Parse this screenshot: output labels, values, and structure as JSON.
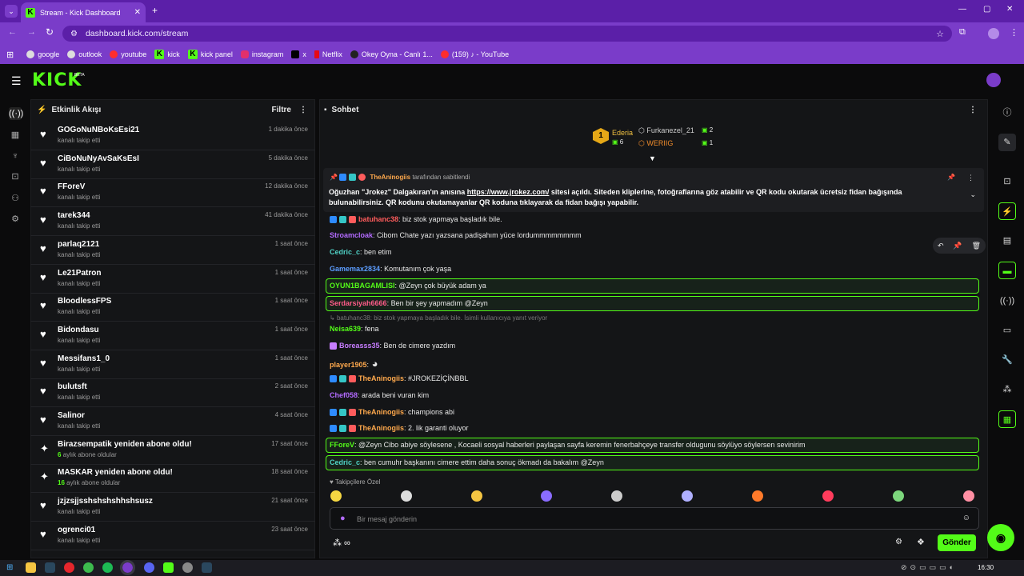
{
  "browser": {
    "tab_title": "Stream - Kick Dashboard",
    "url": "dashboard.kick.com/stream",
    "bookmarks": [
      "google",
      "outlook",
      "youtube",
      "kick",
      "kick panel",
      "instagram",
      "x",
      "Netflix",
      "Okey Oyna - Canlı 1...",
      "(159) ♪ - YouTube"
    ]
  },
  "site": {
    "logo": "KICK",
    "beta": "BETA"
  },
  "activity": {
    "title": "Etkinlik Akışı",
    "filter": "Filtre",
    "items": [
      {
        "name": "GOGoNuNBoKsEsi21",
        "sub": "kanalı takip etti",
        "time": "1 dakika önce",
        "icon": "heart-icon"
      },
      {
        "name": "CiBoNuNyAvSaKsEsI",
        "sub": "kanalı takip etti",
        "time": "5 dakika önce",
        "icon": "heart-icon"
      },
      {
        "name": "FForeV",
        "sub": "kanalı takip etti",
        "time": "12 dakika önce",
        "icon": "heart-icon"
      },
      {
        "name": "tarek344",
        "sub": "kanalı takip etti",
        "time": "41 dakika önce",
        "icon": "heart-icon"
      },
      {
        "name": "parlaq2121",
        "sub": "kanalı takip etti",
        "time": "1 saat önce",
        "icon": "heart-icon"
      },
      {
        "name": "Le21Patron",
        "sub": "kanalı takip etti",
        "time": "1 saat önce",
        "icon": "heart-icon"
      },
      {
        "name": "BloodlessFPS",
        "sub": "kanalı takip etti",
        "time": "1 saat önce",
        "icon": "heart-icon"
      },
      {
        "name": "Bidondasu",
        "sub": "kanalı takip etti",
        "time": "1 saat önce",
        "icon": "heart-icon"
      },
      {
        "name": "Messifans1_0",
        "sub": "kanalı takip etti",
        "time": "1 saat önce",
        "icon": "heart-icon"
      },
      {
        "name": "bulutsft",
        "sub": "kanalı takip etti",
        "time": "2 saat önce",
        "icon": "heart-icon"
      },
      {
        "name": "Salinor",
        "sub": "kanalı takip etti",
        "time": "4 saat önce",
        "icon": "heart-icon"
      },
      {
        "name": "Birazsempatik yeniden abone oldu!",
        "sub_count": "6",
        "sub": "aylık abone oldular",
        "time": "17 saat önce",
        "icon": "sparkle-icon"
      },
      {
        "name": "MASKAR yeniden abone oldu!",
        "sub_count": "16",
        "sub": "aylık abone oldular",
        "time": "18 saat önce",
        "icon": "sparkle-icon"
      },
      {
        "name": "jzjzsjjsshshshshhshsusz",
        "sub": "kanalı takip etti",
        "time": "21 saat önce",
        "icon": "heart-icon"
      },
      {
        "name": "ogrenci01",
        "sub": "kanalı takip etti",
        "time": "23 saat önce",
        "icon": "heart-icon"
      }
    ]
  },
  "chat": {
    "title": "Sohbet",
    "leaderboard": {
      "first": {
        "name": "Ederia",
        "count": "6",
        "rank": "1"
      },
      "second": {
        "name": "Furkanezel_21",
        "count": "2"
      },
      "third": {
        "name": "WERIIG",
        "count": "1"
      }
    },
    "pinned": {
      "author": "TheAninogiis",
      "suffix": "tarafından sabitlendi",
      "text_before": "Oğuzhan \"Jrokez\" Dalgakıran'ın anısına ",
      "link": "https://www.jrokez.com/",
      "text_after": " sitesi açıldı. Siteden kliplerine, fotoğraflarına göz atabilir ve QR kodu okutarak ücretsiz fidan bağışında bulunabilirsiniz. QR kodunu okutamayanlar QR koduna tıklayarak da fidan bağışı yapabilir."
    },
    "messages": [
      {
        "user": "batuhanc38",
        "color": "#ff5c5c",
        "text": ": biz stok yapmaya başladık bile."
      },
      {
        "user": "Stroamcloak",
        "color": "#b36bff",
        "text": ": Cibom Chate yazı yazsana padişahım yüce lordummmmmmmm"
      },
      {
        "user": "Cedric_c",
        "color": "#4fd1c5",
        "text": ": ben etim"
      },
      {
        "user": "Gamemax2834",
        "color": "#5c9dff",
        "text": ": Komutanım çok yaşa"
      },
      {
        "user": "OYUN1BAGAMLISI",
        "color": "#53fc18",
        "text": ": @Zeyn çok büyük adam ya"
      },
      {
        "user": "Serdarsiyah6666",
        "color": "#ff5c8a",
        "text": ": Ben bir şey yapmadım @Zeyn"
      },
      {
        "reply": "batuhanc38: biz stok yapmaya başladık bile. İsimli kullanıcıya yanıt veriyor"
      },
      {
        "user": "Neisa639",
        "color": "#53fc18",
        "text": ": fena"
      },
      {
        "user": "Boreasss35",
        "color": "#c77dff",
        "text": ": Ben de cimere yazdım"
      },
      {
        "user": "player1905",
        "color": "#ffa94d",
        "text": ":"
      },
      {
        "user": "TheAninogiis",
        "color": "#ffa94d",
        "text": ": #JROKEZİÇİNBBL"
      },
      {
        "user": "Chef058",
        "color": "#b36bff",
        "text": ": arada beni vuran kim"
      },
      {
        "user": "TheAninogiis",
        "color": "#ffa94d",
        "text": ": champions abi"
      },
      {
        "user": "TheAninogiis",
        "color": "#ffa94d",
        "text": ": 2. lik garanti oluyor"
      },
      {
        "user": "FForeV",
        "color": "#53fc18",
        "text": ": @Zeyn Cibo abiye söylesene , Kocaeli sosyal haberleri paylaşan sayfa keremin fenerbahçeye transfer oldugunu söylüyo söylersen sevinirim"
      },
      {
        "user": "Cedric_c",
        "color": "#4fd1c5",
        "text": ": ben cumuhr başkanını cimere ettim daha sonuç ökmadı da bakalım @Zeyn"
      }
    ],
    "emote_section": "Takipçilere Özel",
    "input_placeholder": "Bir mesaj gönderin",
    "send": "Gönder"
  },
  "taskbar": {
    "time": "16:30"
  }
}
